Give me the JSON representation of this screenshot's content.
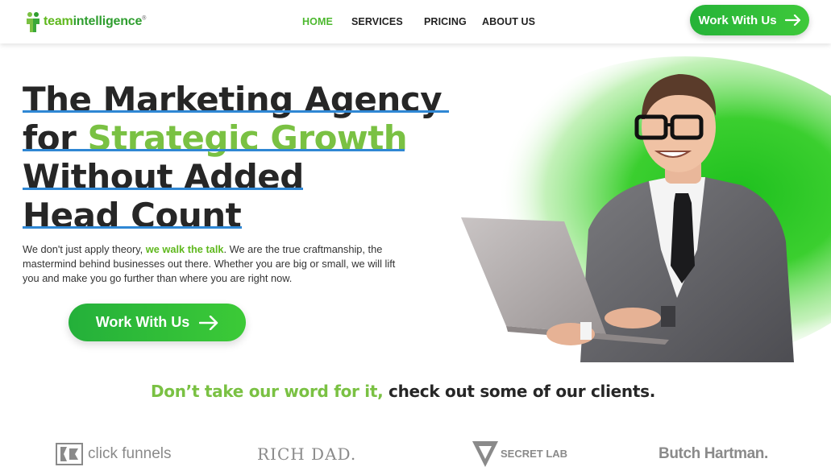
{
  "header": {
    "logo": {
      "part1": "team",
      "part2": "intelligence",
      "mark": "®"
    },
    "nav": [
      {
        "label": "HOME",
        "active": true
      },
      {
        "label": "SERVICES",
        "active": false
      },
      {
        "label": "PRICING",
        "active": false
      },
      {
        "label": "ABOUT US",
        "active": false
      }
    ],
    "cta_label": "Work With Us",
    "cta_icon": "arrow-right-icon"
  },
  "hero": {
    "line1": "The Marketing Agency",
    "line2_plain": "for ",
    "line2_green": "Strategic Growth",
    "line3": "Without Added",
    "line4": "Head Count",
    "desc_before": "We don't just apply theory, ",
    "desc_highlight": "we walk the talk",
    "desc_after": ". We are the true craftmanship, the mastermind behind businesses out there. Whether you are big or small, we will lift you and make you go further than where you are right now.",
    "cta_label": "Work With Us",
    "cta_icon": "arrow-right-icon"
  },
  "clients": {
    "title_green": "Don’t take our word for it,",
    "title_dark": " check out some of our clients.",
    "logos": [
      {
        "name": "click funnels"
      },
      {
        "name": "RICH DAD."
      },
      {
        "name": "SECRET LAB"
      },
      {
        "name": "Butch Hartman."
      }
    ]
  },
  "colors": {
    "brand_green": "#7ac143",
    "button_green": "#2dbb3a",
    "underline_blue": "#2f87d4",
    "text_dark": "#262626"
  }
}
